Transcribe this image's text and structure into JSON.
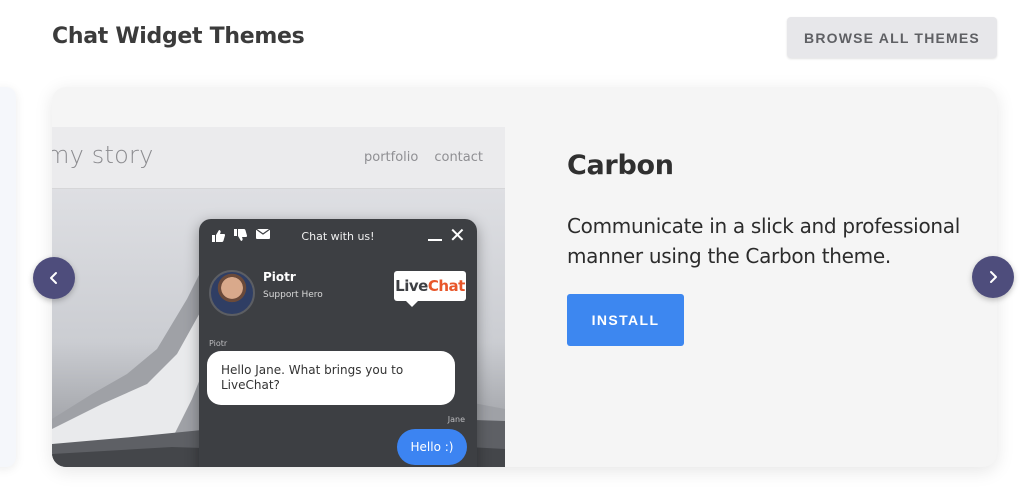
{
  "header": {
    "title": "Chat Widget Themes",
    "browse_label": "BROWSE ALL THEMES"
  },
  "preview": {
    "site_logo": "my story",
    "nav": [
      "portfolio",
      "contact"
    ],
    "chat": {
      "title": "Chat with us!",
      "agent_name": "Piotr",
      "agent_role": "Support Hero",
      "brand_part1": "Live",
      "brand_part2": "Chat",
      "sender_agent": "Piotr",
      "agent_message": "Hello Jane. What brings you to LiveChat?",
      "sender_visitor": "Jane",
      "visitor_message": "Hello :)"
    }
  },
  "theme": {
    "name": "Carbon",
    "description": "Communicate in a slick and professional manner using the Carbon theme.",
    "install_label": "INSTALL"
  },
  "icons": {
    "prev": "chevron-left-icon",
    "next": "chevron-right-icon",
    "thumbs_up": "thumbs-up-icon",
    "thumbs_down": "thumbs-down-icon",
    "email": "email-icon",
    "minimize": "minimize-icon",
    "close": "close-icon"
  },
  "colors": {
    "accent": "#3d87f0",
    "nav_arrow": "#4e4d7c",
    "chat_bg": "#3d3f43",
    "brand_orange": "#e8562a"
  }
}
